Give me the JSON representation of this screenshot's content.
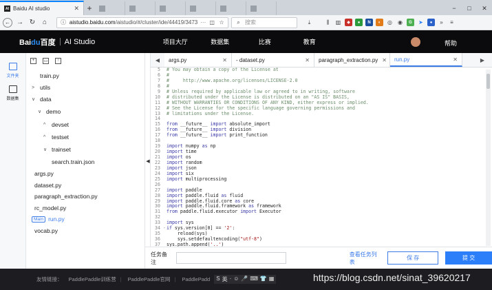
{
  "browser": {
    "active_tab": {
      "favicon": "AI",
      "title": "Baidu AI studio"
    },
    "ghost_tabs": [
      "",
      "",
      "",
      "",
      "",
      ""
    ],
    "window_controls": [
      "−",
      "□",
      "✕"
    ],
    "url_host": "aistudio.baidu.com",
    "url_path": "/aistudio/#/cluster/ide/44419/3473",
    "url_dots": "···",
    "search_placeholder": "搜索"
  },
  "header": {
    "brand_mark_a": "Bai",
    "brand_mark_b": "du",
    "brand_mark_c": "百度",
    "product": "AI Studio",
    "nav": [
      "项目大厅",
      "数据集",
      "比赛",
      "教育"
    ],
    "help": "帮助"
  },
  "rail": {
    "files": "文件夹",
    "datasets": "数据集"
  },
  "tree": {
    "items": [
      {
        "label": "train.py",
        "chev": ""
      },
      {
        "label": "utils",
        "chev": ">"
      },
      {
        "label": "data",
        "chev": "∨"
      },
      {
        "label": "demo",
        "chev": "∨"
      },
      {
        "label": "devset",
        "chev": "^"
      },
      {
        "label": "testset",
        "chev": "^"
      },
      {
        "label": "trainset",
        "chev": "∨"
      },
      {
        "label": "search.train.json",
        "chev": ""
      },
      {
        "label": "args.py",
        "chev": ""
      },
      {
        "label": "dataset.py",
        "chev": ""
      },
      {
        "label": "paragraph_extraction.py",
        "chev": ""
      },
      {
        "label": "rc_model.py",
        "chev": ""
      },
      {
        "label": "run.py",
        "chev": "",
        "badge": "Main"
      },
      {
        "label": "vocab.py",
        "chev": ""
      }
    ]
  },
  "editor": {
    "tabs": [
      {
        "label": "args.py",
        "active": false
      },
      {
        "label": "- dataset.py",
        "active": false
      },
      {
        "label": "paragraph_extraction.py",
        "active": false
      },
      {
        "label": "run.py",
        "active": true
      }
    ],
    "lines": [
      {
        "n": "5",
        "t": "# You may obtain a copy of the License at",
        "c": true
      },
      {
        "n": "6",
        "t": "#",
        "c": true
      },
      {
        "n": "7",
        "t": "#     http://www.apache.org/licenses/LICENSE-2.0",
        "c": true
      },
      {
        "n": "8",
        "t": "#",
        "c": true
      },
      {
        "n": "9",
        "t": "# Unless required by applicable law or agreed to in writing, software",
        "c": true
      },
      {
        "n": "10",
        "t": "# distributed under the License is distributed on an \"AS IS\" BASIS,",
        "c": true
      },
      {
        "n": "11",
        "t": "# WITHOUT WARRANTIES OR CONDITIONS OF ANY KIND, either express or implied.",
        "c": true
      },
      {
        "n": "12",
        "t": "# See the License for the specific language governing permissions and",
        "c": true
      },
      {
        "n": "13",
        "t": "# limitations under the License.",
        "c": true
      },
      {
        "n": "14",
        "t": ""
      },
      {
        "n": "15",
        "t": "from __future__ import absolute_import"
      },
      {
        "n": "16",
        "t": "from __future__ import division"
      },
      {
        "n": "17",
        "t": "from __future__ import print_function"
      },
      {
        "n": "18",
        "t": ""
      },
      {
        "n": "19",
        "t": "import numpy as np"
      },
      {
        "n": "20",
        "t": "import time"
      },
      {
        "n": "21",
        "t": "import os"
      },
      {
        "n": "22",
        "t": "import random"
      },
      {
        "n": "23",
        "t": "import json"
      },
      {
        "n": "24",
        "t": "import six"
      },
      {
        "n": "25",
        "t": "import multiprocessing"
      },
      {
        "n": "26",
        "t": ""
      },
      {
        "n": "27",
        "t": "import paddle"
      },
      {
        "n": "28",
        "t": "import paddle.fluid as fluid"
      },
      {
        "n": "29",
        "t": "import paddle.fluid.core as core"
      },
      {
        "n": "30",
        "t": "import paddle.fluid.framework as framework"
      },
      {
        "n": "31",
        "t": "from paddle.fluid.executor import Executor"
      },
      {
        "n": "32",
        "t": ""
      },
      {
        "n": "33",
        "t": "import sys"
      },
      {
        "n": "34",
        "t": "if sys.version[0] == '2':",
        "fold": "-"
      },
      {
        "n": "35",
        "t": "    reload(sys)"
      },
      {
        "n": "36",
        "t": "    sys.setdefaultencoding(\"utf-8\")"
      },
      {
        "n": "37",
        "t": "sys.path.append('..')"
      },
      {
        "n": "38",
        "t": ""
      }
    ]
  },
  "footer": {
    "remark_label": "任务备注",
    "remark_value": "",
    "history_link": "查看任务列表",
    "save": "保 存",
    "submit": "提 交"
  },
  "site_footer": {
    "label": "友情链接：",
    "links": [
      "PaddlePaddle训练营",
      "PaddlePaddle官网",
      "PaddlePadd"
    ],
    "ime": [
      "S",
      "英",
      "·",
      "☺",
      "🎤",
      "⌨",
      "👕",
      "▦"
    ]
  },
  "watermark": "https://blog.csdn.net/sinat_39620217",
  "colors": {
    "accent": "#3b7be8",
    "header_bg": "#0b0b0d",
    "submit_bg": "#2d7ff9"
  }
}
